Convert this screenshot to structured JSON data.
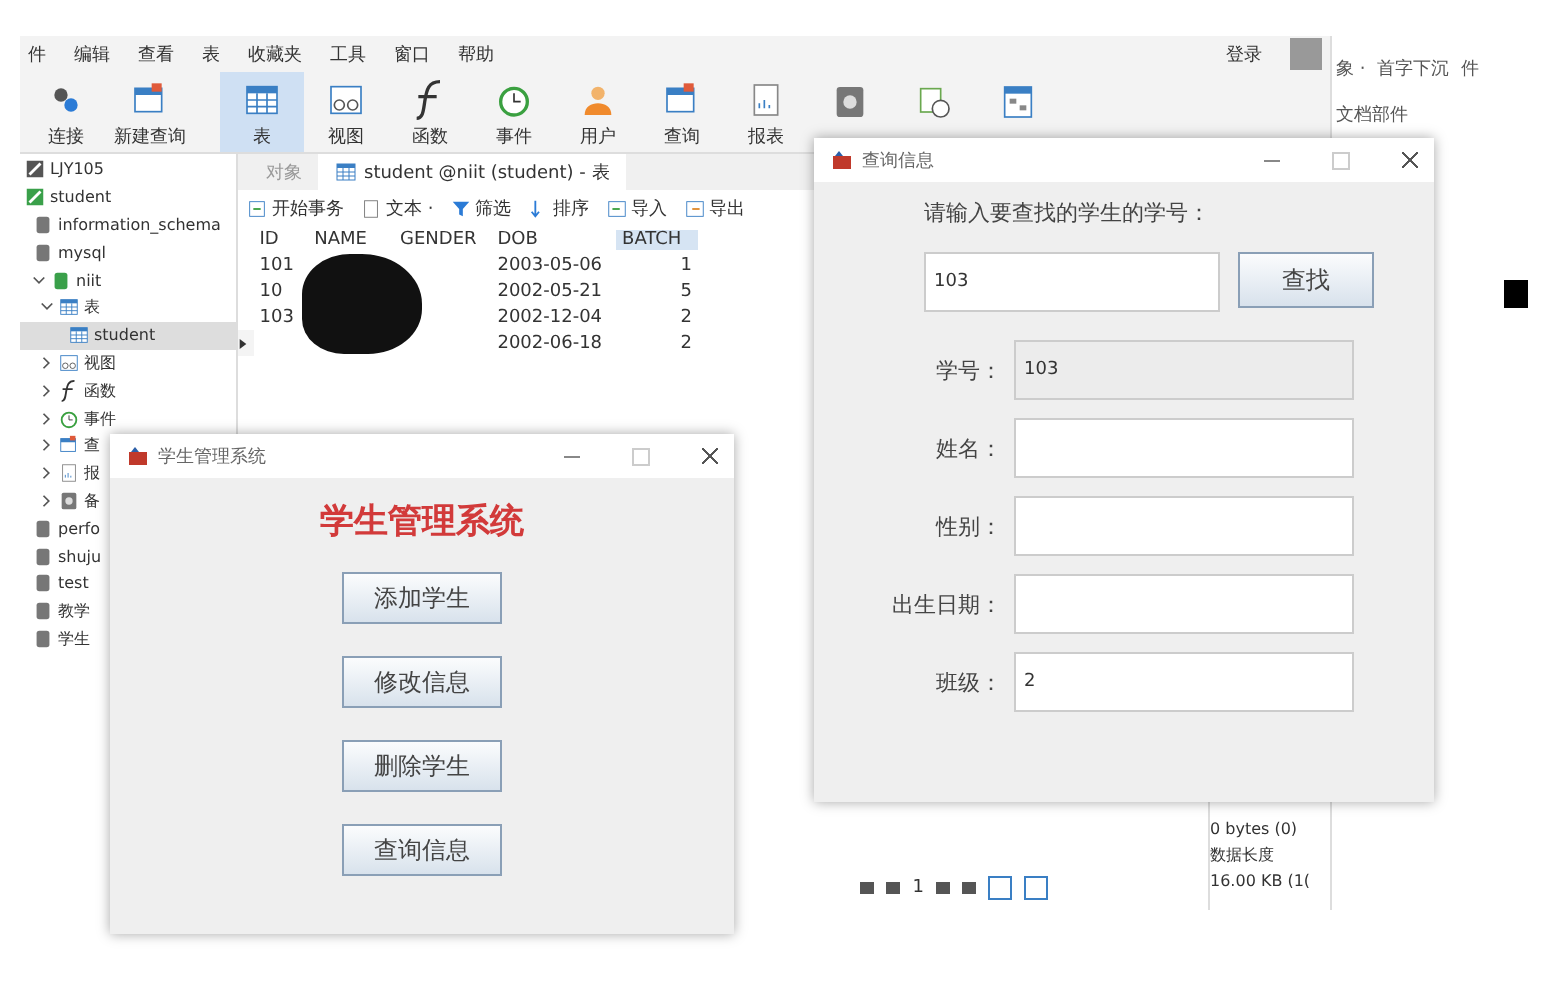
{
  "menu": [
    "件",
    "编辑",
    "查看",
    "表",
    "收藏夹",
    "工具",
    "窗口",
    "帮助"
  ],
  "login": "登录",
  "toolbar": [
    {
      "label": "连接",
      "selected": false
    },
    {
      "label": "新建查询",
      "selected": false
    },
    {
      "label": "表",
      "selected": true
    },
    {
      "label": "视图",
      "selected": false
    },
    {
      "label": "函数",
      "selected": false
    },
    {
      "label": "事件",
      "selected": false
    },
    {
      "label": "用户",
      "selected": false
    },
    {
      "label": "查询",
      "selected": false
    },
    {
      "label": "报表",
      "selected": false
    },
    {
      "selected": false
    },
    {
      "selected": false
    },
    {
      "selected": false
    }
  ],
  "sidebar": {
    "items": [
      {
        "label": "LJY105",
        "kind": "connection",
        "selected": false
      },
      {
        "label": "student",
        "kind": "connection",
        "selected": false,
        "children": [
          {
            "label": "information_schema",
            "kind": "database",
            "selected": false
          },
          {
            "label": "mysql",
            "kind": "database",
            "selected": false
          },
          {
            "label": "niit",
            "kind": "database",
            "expanded": true,
            "selected": false,
            "children": [
              {
                "label": "表",
                "kind": "table",
                "expanded": true,
                "selected": false,
                "children": [
                  {
                    "label": "student",
                    "kind": "table",
                    "selected": true
                  }
                ]
              },
              {
                "label": "视图",
                "kind": "view",
                "expanded": false,
                "selected": false
              },
              {
                "label": "函数",
                "kind": "function",
                "expanded": false,
                "selected": false
              },
              {
                "label": "事件",
                "kind": "event",
                "expanded": false,
                "selected": false
              },
              {
                "label": "查",
                "kind": "query",
                "expanded": false,
                "selected": false
              },
              {
                "label": "报",
                "kind": "report",
                "expanded": false,
                "selected": false
              },
              {
                "label": "备",
                "kind": "backup",
                "expanded": false,
                "selected": false
              }
            ]
          },
          {
            "label": "perfo",
            "kind": "database",
            "selected": false
          },
          {
            "label": "shuju",
            "kind": "database",
            "selected": false
          },
          {
            "label": "test",
            "kind": "database",
            "selected": false
          },
          {
            "label": "教学",
            "kind": "database",
            "selected": false
          },
          {
            "label": "学生",
            "kind": "database",
            "selected": false
          }
        ]
      }
    ]
  },
  "tabs": [
    {
      "label": "对象",
      "selected": false
    },
    {
      "label": "student @niit (student) - 表",
      "selected": true
    }
  ],
  "table_toolbar": [
    "开始事务",
    "文本 ·",
    "筛选",
    "排序",
    "导入",
    "导出"
  ],
  "table": {
    "columns": [
      {
        "label": "ID",
        "selected": false
      },
      {
        "label": "NAME",
        "selected": false
      },
      {
        "label": "GENDER",
        "selected": false
      },
      {
        "label": "DOB",
        "selected": false
      },
      {
        "label": "BATCH",
        "selected": true
      }
    ],
    "rows": [
      {
        "current": false,
        "cells": [
          "101",
          null,
          null,
          "2003-05-06",
          "1"
        ]
      },
      {
        "current": false,
        "cells": [
          "10",
          null,
          null,
          "2002-05-21",
          "5"
        ]
      },
      {
        "current": false,
        "cells": [
          "103",
          null,
          null,
          "2002-12-04",
          "2"
        ]
      },
      {
        "current": true,
        "cells": [
          null,
          null,
          null,
          "2002-06-18",
          "2"
        ]
      }
    ]
  },
  "pager": {
    "page": "1"
  },
  "info_panel": [
    "0 bytes (0)",
    "数据长度",
    "16.00 KB (1("
  ],
  "side_app": [
    "象 ·",
    "首字下沉",
    "件",
    "文档部件"
  ],
  "manage_window": {
    "title": "学生管理系统",
    "heading": "学生管理系统",
    "buttons": [
      "添加学生",
      "修改信息",
      "删除学生",
      "查询信息"
    ]
  },
  "query_window": {
    "title": "查询信息",
    "prompt": "请输入要查找的学生的学号：",
    "search_value": "103",
    "search_button": "查找",
    "fields": [
      {
        "label": "学号：",
        "value": "103",
        "disabled": true
      },
      {
        "label": "姓名：",
        "disabled": false
      },
      {
        "label": "性别：",
        "disabled": false
      },
      {
        "label": "出生日期：",
        "disabled": false
      },
      {
        "label": "班级：",
        "value": "2",
        "disabled": false
      }
    ]
  }
}
